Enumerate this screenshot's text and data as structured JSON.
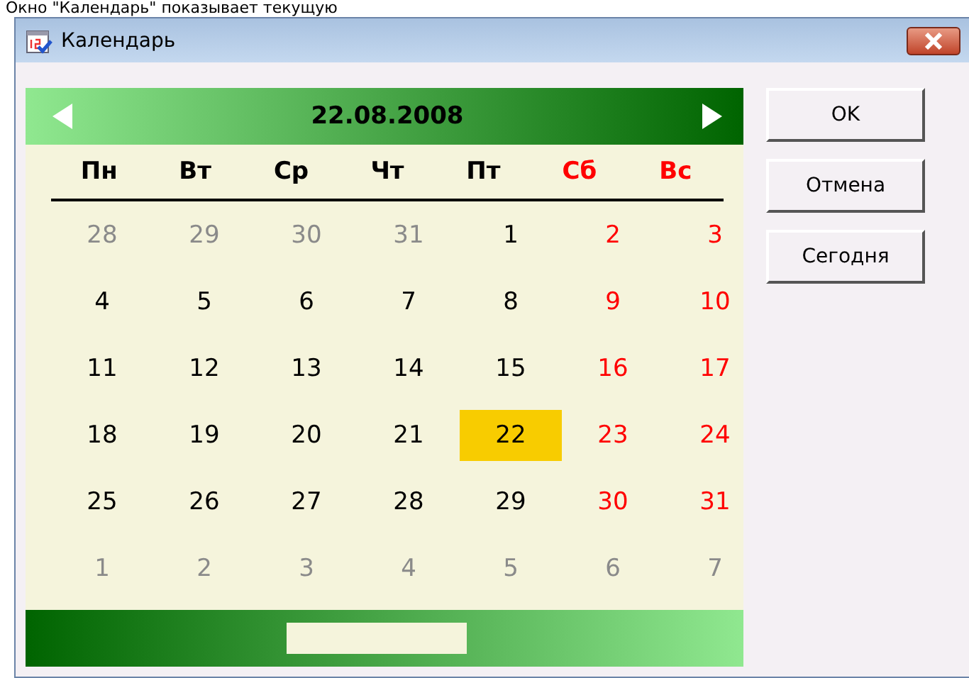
{
  "caption": "Окно \"Календарь\" показывает текущую",
  "window": {
    "title": "Календарь"
  },
  "calendar": {
    "header": "22.08.2008",
    "weekdays": [
      {
        "label": "Пн",
        "weekend": false
      },
      {
        "label": "Вт",
        "weekend": false
      },
      {
        "label": "Ср",
        "weekend": false
      },
      {
        "label": "Чт",
        "weekend": false
      },
      {
        "label": "Пт",
        "weekend": false
      },
      {
        "label": "Сб",
        "weekend": true
      },
      {
        "label": "Вс",
        "weekend": true
      }
    ],
    "weeks": [
      [
        {
          "day": "28",
          "kind": "outside",
          "selected": false
        },
        {
          "day": "29",
          "kind": "outside",
          "selected": false
        },
        {
          "day": "30",
          "kind": "outside",
          "selected": false
        },
        {
          "day": "31",
          "kind": "outside",
          "selected": false
        },
        {
          "day": "1",
          "kind": "weekday",
          "selected": false
        },
        {
          "day": "2",
          "kind": "weekend",
          "selected": false
        },
        {
          "day": "3",
          "kind": "weekend",
          "selected": false
        }
      ],
      [
        {
          "day": "4",
          "kind": "weekday",
          "selected": false
        },
        {
          "day": "5",
          "kind": "weekday",
          "selected": false
        },
        {
          "day": "6",
          "kind": "weekday",
          "selected": false
        },
        {
          "day": "7",
          "kind": "weekday",
          "selected": false
        },
        {
          "day": "8",
          "kind": "weekday",
          "selected": false
        },
        {
          "day": "9",
          "kind": "weekend",
          "selected": false
        },
        {
          "day": "10",
          "kind": "weekend",
          "selected": false
        }
      ],
      [
        {
          "day": "11",
          "kind": "weekday",
          "selected": false
        },
        {
          "day": "12",
          "kind": "weekday",
          "selected": false
        },
        {
          "day": "13",
          "kind": "weekday",
          "selected": false
        },
        {
          "day": "14",
          "kind": "weekday",
          "selected": false
        },
        {
          "day": "15",
          "kind": "weekday",
          "selected": false
        },
        {
          "day": "16",
          "kind": "weekend",
          "selected": false
        },
        {
          "day": "17",
          "kind": "weekend",
          "selected": false
        }
      ],
      [
        {
          "day": "18",
          "kind": "weekday",
          "selected": false
        },
        {
          "day": "19",
          "kind": "weekday",
          "selected": false
        },
        {
          "day": "20",
          "kind": "weekday",
          "selected": false
        },
        {
          "day": "21",
          "kind": "weekday",
          "selected": false
        },
        {
          "day": "22",
          "kind": "weekday",
          "selected": true
        },
        {
          "day": "23",
          "kind": "weekend",
          "selected": false
        },
        {
          "day": "24",
          "kind": "weekend",
          "selected": false
        }
      ],
      [
        {
          "day": "25",
          "kind": "weekday",
          "selected": false
        },
        {
          "day": "26",
          "kind": "weekday",
          "selected": false
        },
        {
          "day": "27",
          "kind": "weekday",
          "selected": false
        },
        {
          "day": "28",
          "kind": "weekday",
          "selected": false
        },
        {
          "day": "29",
          "kind": "weekday",
          "selected": false
        },
        {
          "day": "30",
          "kind": "weekend",
          "selected": false
        },
        {
          "day": "31",
          "kind": "weekend",
          "selected": false
        }
      ],
      [
        {
          "day": "1",
          "kind": "outside",
          "selected": false
        },
        {
          "day": "2",
          "kind": "outside",
          "selected": false
        },
        {
          "day": "3",
          "kind": "outside",
          "selected": false
        },
        {
          "day": "4",
          "kind": "outside",
          "selected": false
        },
        {
          "day": "5",
          "kind": "outside",
          "selected": false
        },
        {
          "day": "6",
          "kind": "outside",
          "selected": false
        },
        {
          "day": "7",
          "kind": "outside",
          "selected": false
        }
      ]
    ]
  },
  "buttons": [
    "OK",
    "Отмена",
    "Сегодня"
  ]
}
